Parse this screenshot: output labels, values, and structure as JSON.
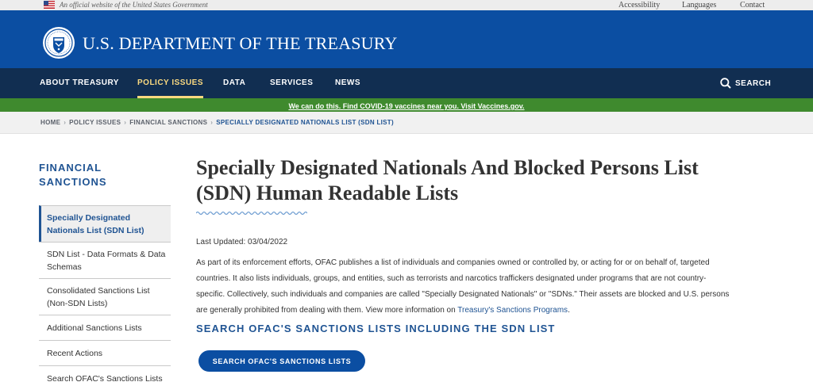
{
  "gov_banner": {
    "official_text": "An official website of the United States Government",
    "utility_links": [
      "Accessibility",
      "Languages",
      "Contact"
    ]
  },
  "header": {
    "site_title": "U.S. DEPARTMENT OF THE TREASURY",
    "brand_color": "#0b4ea2"
  },
  "main_nav": {
    "items": [
      "ABOUT TREASURY",
      "POLICY ISSUES",
      "DATA",
      "SERVICES",
      "NEWS"
    ],
    "active": "POLICY ISSUES",
    "search_label": "SEARCH",
    "active_color": "#fad980"
  },
  "alert": {
    "text": "We can do this. Find COVID-19 vaccines near you. Visit Vaccines.gov."
  },
  "breadcrumb": {
    "items": [
      "HOME",
      "POLICY ISSUES",
      "FINANCIAL SANCTIONS",
      "SPECIALLY DESIGNATED NATIONALS LIST (SDN LIST)"
    ]
  },
  "sidebar": {
    "heading_line1": "FINANCIAL",
    "heading_line2": "SANCTIONS",
    "items": [
      {
        "line1": "Specially Designated",
        "line2": "Nationals List (SDN List)"
      },
      {
        "line1": "SDN List - Data Formats & Data",
        "line2": "Schemas"
      },
      {
        "line1": "Consolidated Sanctions List",
        "line2": "(Non-SDN Lists)"
      },
      {
        "line1": "Additional Sanctions Lists",
        "line2": ""
      },
      {
        "line1": "Recent Actions",
        "line2": ""
      },
      {
        "line1": "Search OFAC's Sanctions Lists",
        "line2": ""
      }
    ]
  },
  "main": {
    "title_line1": "Specially Designated Nationals And Blocked Persons List",
    "title_line2": "(SDN) Human Readable Lists",
    "last_updated": "Last Updated: 03/04/2022",
    "intro_line1": "As part of its enforcement efforts, OFAC publishes a list of individuals and companies owned or controlled by, or acting for or on behalf of, targeted",
    "intro_line2": "countries. It also lists individuals, groups, and entities, such as terrorists and narcotics traffickers designated under programs that are not country-",
    "intro_line3": "specific. Collectively, such individuals and companies are called \"Specially Designated Nationals\" or \"SDNs.\" Their assets are blocked and U.S. persons",
    "intro_line4_prefix": "are generally prohibited from dealing with them.  View more information on ",
    "intro_link": "Treasury's Sanctions Programs",
    "intro_line4_suffix": ".",
    "section_heading": "SEARCH OFAC'S SANCTIONS LISTS INCLUDING THE SDN LIST",
    "cta_label": "SEARCH OFAC'S SANCTIONS LISTS"
  }
}
